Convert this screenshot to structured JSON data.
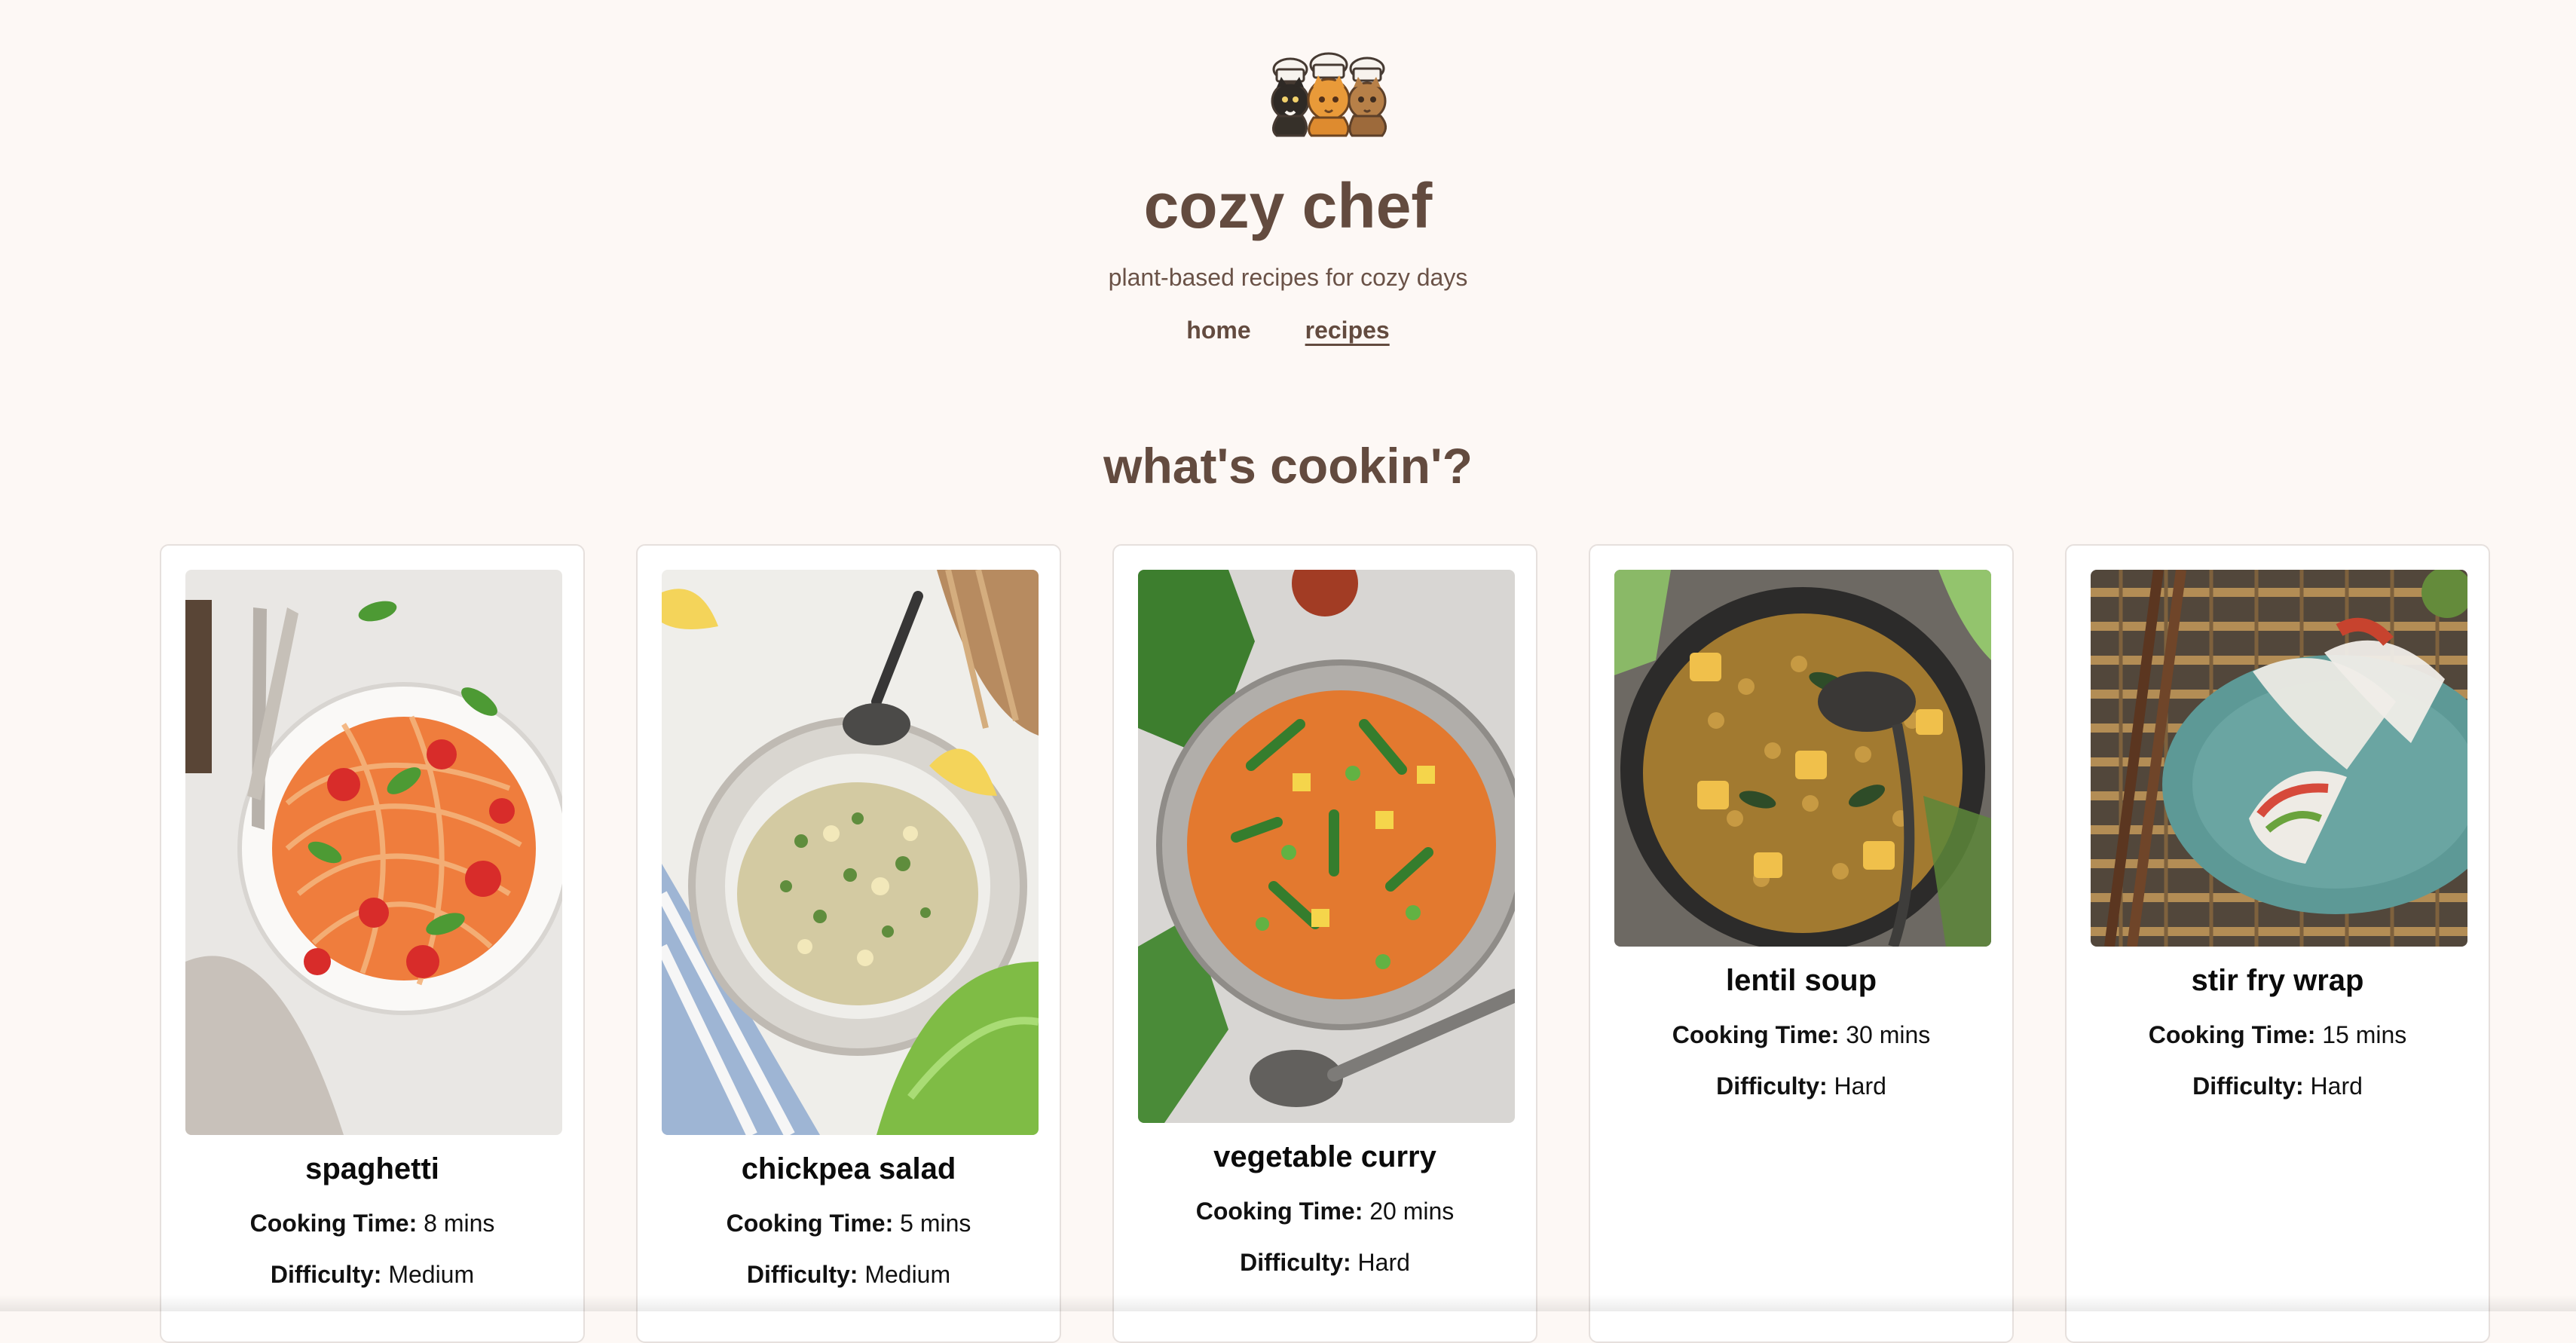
{
  "brand": {
    "logo_name": "three-chef-cats-logo",
    "title": "cozy chef",
    "tagline": "plant-based recipes for cozy days"
  },
  "nav": {
    "items": [
      {
        "label": "home",
        "active": false
      },
      {
        "label": "recipes",
        "active": true
      }
    ]
  },
  "page": {
    "heading": "what's cookin'?"
  },
  "labels": {
    "cooking_time": "Cooking Time:",
    "difficulty": "Difficulty:"
  },
  "recipes": [
    {
      "title": "spaghetti",
      "cooking_time": "8 mins",
      "difficulty": "Medium",
      "image_icon": "spaghetti-plate-image"
    },
    {
      "title": "chickpea salad",
      "cooking_time": "5 mins",
      "difficulty": "Medium",
      "image_icon": "chickpea-salad-bowl-image"
    },
    {
      "title": "vegetable curry",
      "cooking_time": "20 mins",
      "difficulty": "Hard",
      "image_icon": "vegetable-curry-pan-image"
    },
    {
      "title": "lentil soup",
      "cooking_time": "30 mins",
      "difficulty": "Hard",
      "image_icon": "lentil-soup-pot-image"
    },
    {
      "title": "stir fry wrap",
      "cooking_time": "15 mins",
      "difficulty": "Hard",
      "image_icon": "stir-fry-wrap-plate-image"
    }
  ],
  "colors": {
    "page_background": "#fdf8f5",
    "brand_brown": "#634b3f",
    "card_border": "#e6e0dd",
    "text_dark": "#111111"
  }
}
